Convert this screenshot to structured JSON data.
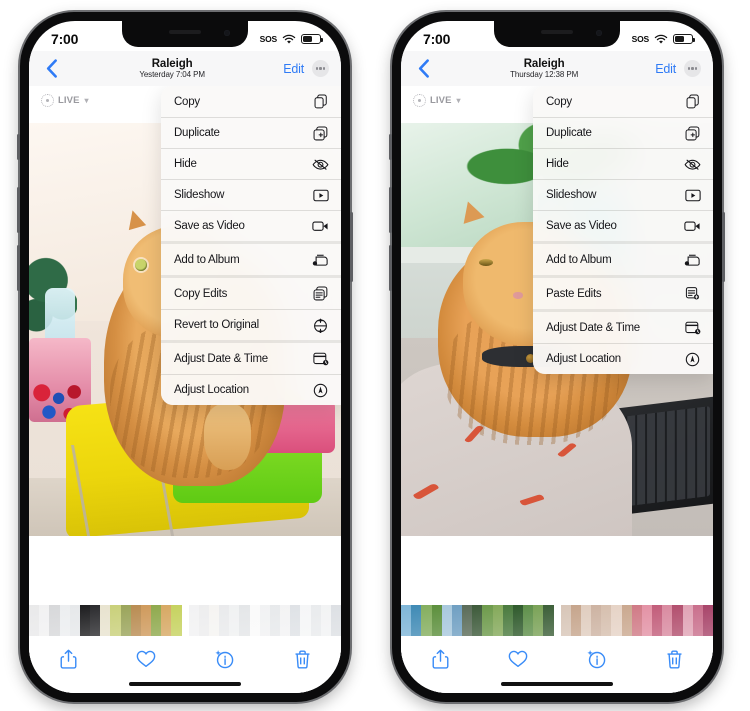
{
  "background_color": "#ffffff",
  "accent_color": "#2f7bf6",
  "phones": [
    {
      "id": "left-phone",
      "status_bar": {
        "time": "7:00",
        "sos": "SOS",
        "wifi_icon": "wifi-icon",
        "battery_icon": "battery-icon"
      },
      "nav": {
        "back_icon": "chevron-left-icon",
        "title": "Raleigh",
        "subtitle": "Yesterday  7:04 PM",
        "edit_label": "Edit",
        "more_icon": "more-circle-icon"
      },
      "live_badge": {
        "label": "LIVE",
        "icon": "live-photo-icon",
        "chevron": "chevron-down-icon"
      },
      "photo_alt": "Orange tabby cat sitting on a yellow chair in a craft room",
      "menu_groups": [
        {
          "items": [
            {
              "label": "Copy",
              "icon": "copy-icon"
            },
            {
              "label": "Duplicate",
              "icon": "duplicate-icon"
            },
            {
              "label": "Hide",
              "icon": "eye-slash-icon"
            },
            {
              "label": "Slideshow",
              "icon": "play-rectangle-icon"
            },
            {
              "label": "Save as Video",
              "icon": "video-camera-icon"
            }
          ]
        },
        {
          "items": [
            {
              "label": "Add to Album",
              "icon": "add-to-album-icon"
            }
          ]
        },
        {
          "items": [
            {
              "label": "Copy Edits",
              "icon": "copy-edits-icon"
            },
            {
              "label": "Revert to Original",
              "icon": "revert-icon"
            }
          ]
        },
        {
          "items": [
            {
              "label": "Adjust Date & Time",
              "icon": "calendar-clock-icon"
            },
            {
              "label": "Adjust Location",
              "icon": "location-circle-icon"
            }
          ]
        }
      ],
      "toolbar": [
        {
          "name": "share-button",
          "icon": "share-icon"
        },
        {
          "name": "favorite-button",
          "icon": "heart-icon"
        },
        {
          "name": "info-button",
          "icon": "info-sparkle-icon"
        },
        {
          "name": "delete-button",
          "icon": "trash-icon"
        }
      ],
      "filmstrip_colors": [
        "#e9e9ea",
        "#f1f1f2",
        "#d7d8da",
        "#eceef0",
        "#e6e8ea",
        "#1d1d1f",
        "#2b2b2e",
        "#e8e3cf",
        "#c9d07a",
        "#9aa45a",
        "#b98c52",
        "#cf9a5c",
        "#8fa94d",
        "#d7a863",
        "#c6d25f"
      ],
      "filmstrip_colors_2": [
        "#f2f2f3",
        "#ededee",
        "#f5f4f2",
        "#e9eaec",
        "#f0f1f2",
        "#e4e6e8",
        "#fafafa",
        "#f1f2f3",
        "#e7e9eb",
        "#f3f3f4",
        "#dfe2e6",
        "#f5f6f7",
        "#e9ebed",
        "#f2f3f4",
        "#dde0e4"
      ]
    },
    {
      "id": "right-phone",
      "status_bar": {
        "time": "7:00",
        "sos": "SOS",
        "wifi_icon": "wifi-icon",
        "battery_icon": "battery-icon"
      },
      "nav": {
        "back_icon": "chevron-left-icon",
        "title": "Raleigh",
        "subtitle": "Thursday  12:38 PM",
        "edit_label": "Edit",
        "more_icon": "more-circle-icon"
      },
      "live_badge": {
        "label": "LIVE",
        "icon": "live-photo-icon",
        "chevron": "chevron-down-icon"
      },
      "photo_alt": "Orange tabby cat resting on a blanket beside a laptop near a window",
      "menu_groups": [
        {
          "items": [
            {
              "label": "Copy",
              "icon": "copy-icon"
            },
            {
              "label": "Duplicate",
              "icon": "duplicate-icon"
            },
            {
              "label": "Hide",
              "icon": "eye-slash-icon"
            },
            {
              "label": "Slideshow",
              "icon": "play-rectangle-icon"
            },
            {
              "label": "Save as Video",
              "icon": "video-camera-icon"
            }
          ]
        },
        {
          "items": [
            {
              "label": "Add to Album",
              "icon": "add-to-album-icon"
            }
          ]
        },
        {
          "items": [
            {
              "label": "Paste Edits",
              "icon": "paste-edits-icon"
            }
          ]
        },
        {
          "items": [
            {
              "label": "Adjust Date & Time",
              "icon": "calendar-clock-icon"
            },
            {
              "label": "Adjust Location",
              "icon": "location-circle-icon"
            }
          ]
        }
      ],
      "toolbar": [
        {
          "name": "share-button",
          "icon": "share-icon"
        },
        {
          "name": "favorite-button",
          "icon": "heart-icon"
        },
        {
          "name": "info-button",
          "icon": "info-sparkle-icon"
        },
        {
          "name": "delete-button",
          "icon": "trash-icon"
        }
      ],
      "filmstrip_colors": [
        "#7fb6d8",
        "#3f8ab5",
        "#84ae5e",
        "#5c8f3c",
        "#a8c8dd",
        "#6f9fc2",
        "#5a6b58",
        "#3d5a3a",
        "#6d9a4b",
        "#84a95a",
        "#4a7a3e",
        "#2f5a2c",
        "#5e8f4a",
        "#7aa257",
        "#3c5f38"
      ],
      "filmstrip_colors_2": [
        "#d8c6b8",
        "#c6a58c",
        "#e0cdbf",
        "#cdb3a2",
        "#d6bfae",
        "#e6d3c6",
        "#caa88f",
        "#d07a86",
        "#e392a5",
        "#c25d7a",
        "#d98aa0",
        "#b24f6e",
        "#e0a3b5",
        "#c96f8c",
        "#a8456a"
      ]
    }
  ]
}
